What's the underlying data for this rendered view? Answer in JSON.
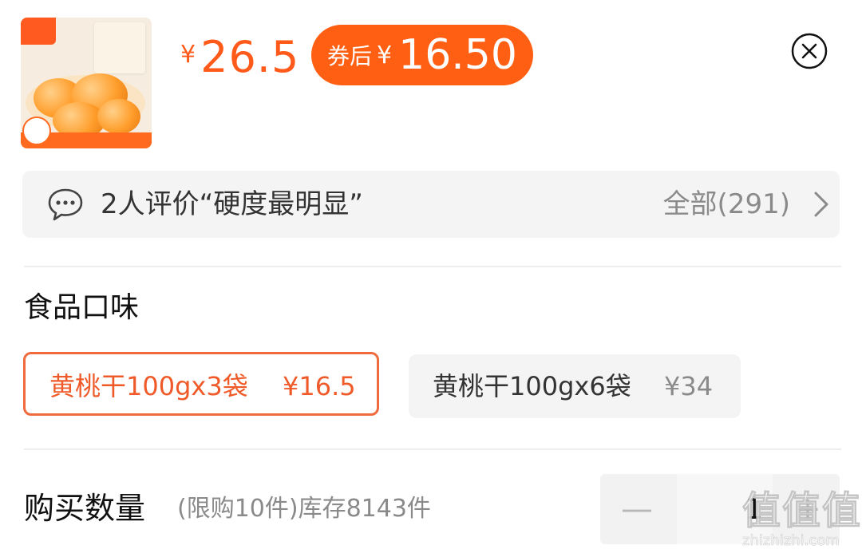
{
  "header": {
    "product_image_icon": "dried-apricot-product-image",
    "currency_symbol": "¥",
    "original_price": "26.5",
    "coupon_label": "券后",
    "coupon_price": "16.50",
    "close_icon": "close-circle-icon"
  },
  "reviews": {
    "icon": "speech-bubble-icon",
    "summary": "2人评价“硬度最明显”",
    "all_label": "全部(291)"
  },
  "flavor": {
    "title": "食品口味",
    "options": [
      {
        "name": "黄桃干100gx3袋",
        "price": "¥16.5",
        "selected": true
      },
      {
        "name": "黄桃干100gx6袋",
        "price": "¥34",
        "selected": false
      }
    ]
  },
  "quantity": {
    "title": "购买数量",
    "limit_text": "(限购10件)库存8143件",
    "minus_symbol": "—",
    "value": "1",
    "plus_symbol": "+"
  },
  "watermark": {
    "logo_text": "值值值",
    "url": "zhizhizhi.com"
  },
  "colors": {
    "accent": "#ff5f12",
    "selected_border": "#ef6a3c",
    "muted_text": "#8a8a8a"
  }
}
